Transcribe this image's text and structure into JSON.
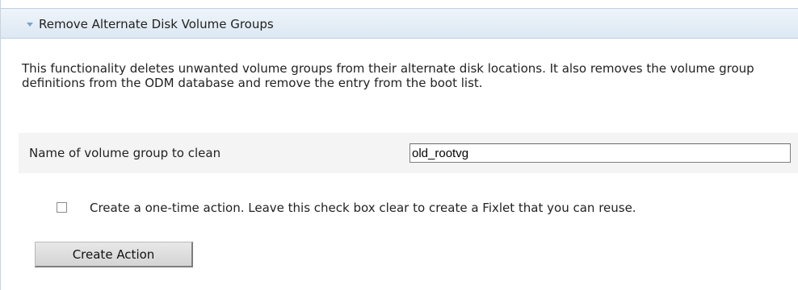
{
  "panel": {
    "title": "Remove Alternate Disk Volume Groups",
    "expanded": true,
    "icon": "chevron-down-icon"
  },
  "description": "This functionality deletes unwanted volume groups from their alternate disk locations. It also removes the volume group definitions from the ODM database and remove the entry from the boot list.",
  "form": {
    "volume_group_label": "Name of volume group to clean",
    "volume_group_value": "old_rootvg"
  },
  "one_time_action": {
    "checked": false,
    "label": "Create a one-time action. Leave this check box clear to create a Fixlet that you can reuse."
  },
  "buttons": {
    "create_action": "Create Action"
  },
  "colors": {
    "header_background": "#dde8f3",
    "header_border": "#c1cfdc",
    "chevron": "#7aa3c9",
    "form_row_background": "#f4f4f4"
  }
}
